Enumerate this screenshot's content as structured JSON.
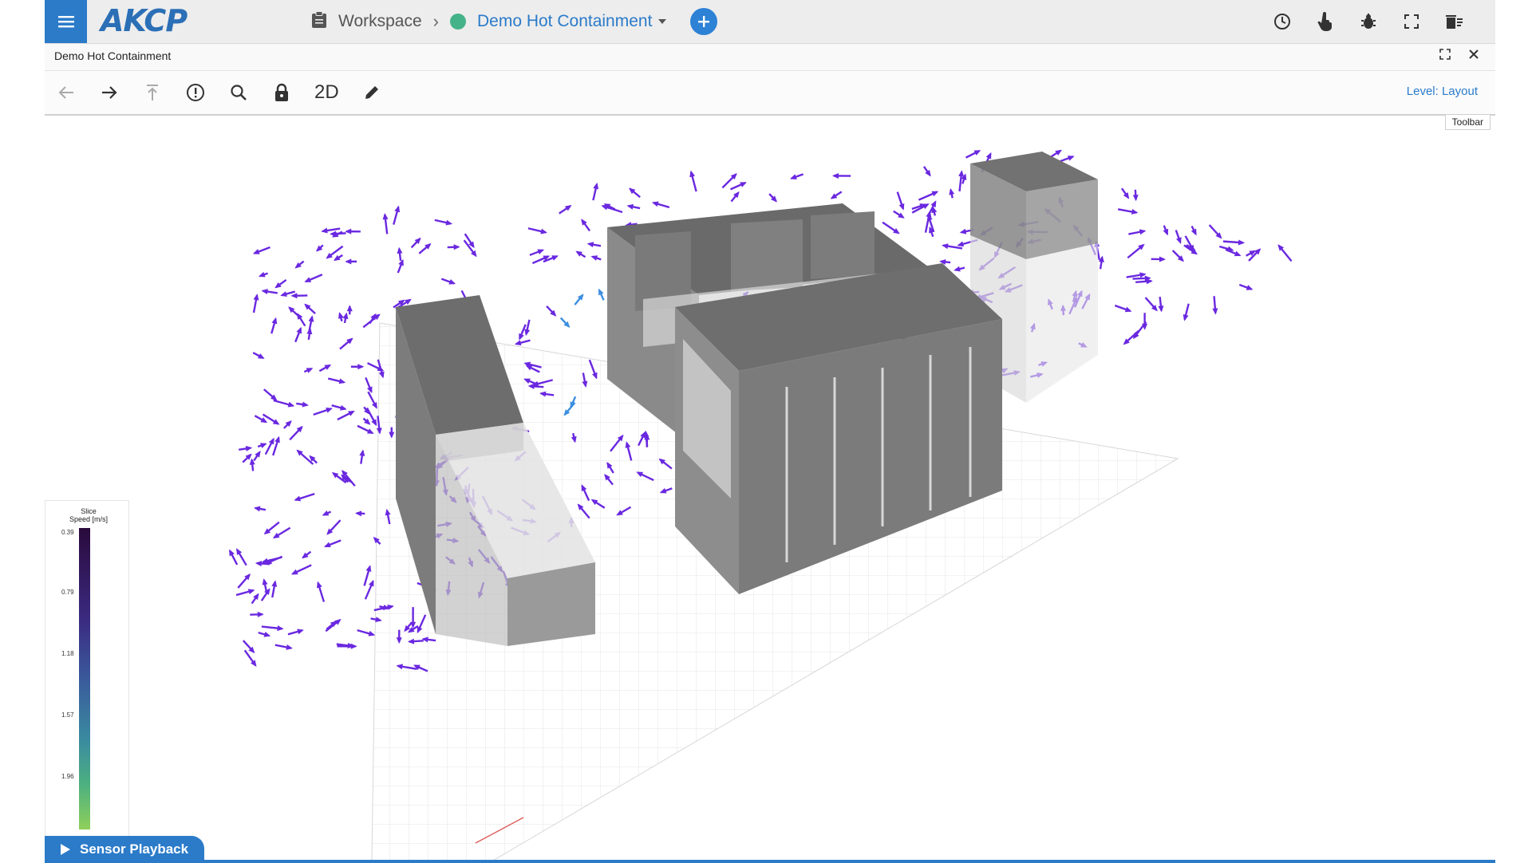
{
  "app": {
    "logo_text": "AKCP",
    "accent": "#2b7bc9"
  },
  "breadcrumb": {
    "workspace_label": "Workspace",
    "current": "Demo Hot Containment",
    "status_color": "#45b38a"
  },
  "top_icons": [
    "clock-icon",
    "touch-icon",
    "bug-icon",
    "fullscreen-icon",
    "trash-list-icon"
  ],
  "window": {
    "title": "Demo Hot Containment"
  },
  "toolbar": {
    "mode_2d_label": "2D",
    "level_label": "Level: Layout",
    "tooltip": "Toolbar",
    "tools": [
      "back-arrow-icon",
      "forward-arrow-icon",
      "up-level-icon",
      "alert-icon",
      "search-icon",
      "lock-icon",
      "2d-toggle",
      "edit-pencil-icon"
    ]
  },
  "colorbar": {
    "title_line1": "Slice",
    "title_line2": "Speed [m/s]",
    "ticks": [
      "0.39",
      "0.79",
      "1.18",
      "1.57",
      "1.96"
    ]
  },
  "playback": {
    "label": "Sensor Playback"
  }
}
